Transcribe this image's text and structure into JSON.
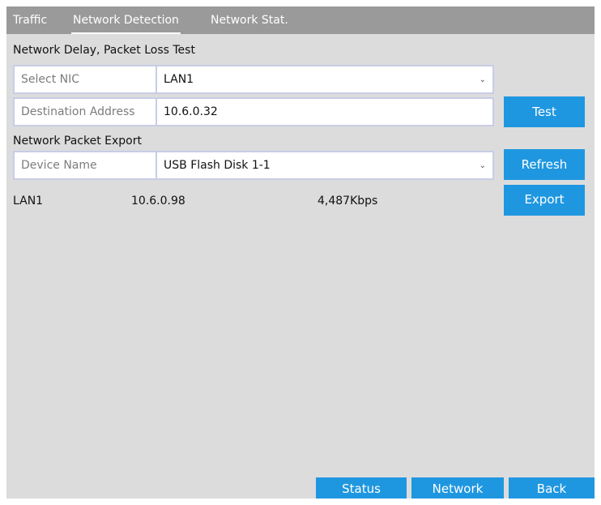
{
  "tabs": [
    {
      "label": "Traffic",
      "active": false
    },
    {
      "label": "Network Detection",
      "active": true
    },
    {
      "label": "Network Stat.",
      "active": false
    }
  ],
  "delay_test": {
    "title": "Network Delay, Packet Loss Test",
    "nic_label": "Select NIC",
    "nic_value": "LAN1",
    "dest_label": "Destination Address",
    "dest_value": "10.6.0.32",
    "test_button": "Test"
  },
  "packet_export": {
    "title": "Network Packet Export",
    "device_label": "Device Name",
    "device_value": "USB Flash Disk 1-1",
    "refresh_button": "Refresh",
    "export_button": "Export",
    "interface": "LAN1",
    "ip": "10.6.0.98",
    "rate": "4,487Kbps"
  },
  "footer": {
    "status_button": "Status",
    "network_button": "Network",
    "back_button": "Back"
  },
  "colors": {
    "accent": "#1f97e0",
    "tabbar": "#9a9a9a",
    "panel": "#dcdcdc",
    "field_border": "#c8cde6"
  }
}
